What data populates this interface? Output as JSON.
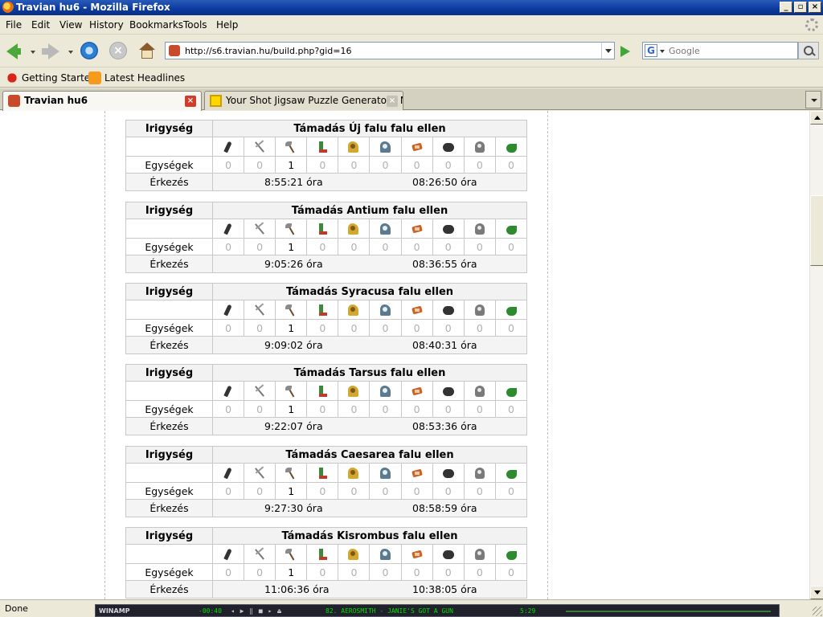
{
  "window": {
    "title": "Travian hu6 - Mozilla Firefox",
    "buttons": [
      "_",
      "▫",
      "×"
    ]
  },
  "menu": [
    "File",
    "Edit",
    "View",
    "History",
    "Bookmarks",
    "Tools",
    "Help"
  ],
  "navbar": {
    "url": "http://s6.travian.hu/build.php?gid=16",
    "search_placeholder": "Google",
    "search_engine_letter": "G"
  },
  "bookmarks": [
    "Getting Started",
    "Latest Headlines"
  ],
  "tabs": [
    {
      "label": "Travian hu6",
      "active": true
    },
    {
      "label": "Your Shot Jigsaw Puzzle Generator - N...",
      "active": false
    }
  ],
  "unit_icons": [
    "club-icon",
    "spear-icon",
    "axe-icon",
    "scout-icon",
    "paladin-icon",
    "teutonic-knight-icon",
    "ram-icon",
    "catapult-icon",
    "chief-icon",
    "settler-icon"
  ],
  "row_labels": {
    "owner": "Irigység",
    "units": "Egységek",
    "arrival": "Érkezés"
  },
  "attacks": [
    {
      "title": "Támadás Új falu falu ellen",
      "units": [
        "0",
        "0",
        "1",
        "0",
        "0",
        "0",
        "0",
        "0",
        "0",
        "0"
      ],
      "time_left": "8:55:21 óra",
      "arrival_at": "08:26:50 óra"
    },
    {
      "title": "Támadás Antium falu ellen",
      "units": [
        "0",
        "0",
        "1",
        "0",
        "0",
        "0",
        "0",
        "0",
        "0",
        "0"
      ],
      "time_left": "9:05:26 óra",
      "arrival_at": "08:36:55 óra"
    },
    {
      "title": "Támadás Syracusa falu ellen",
      "units": [
        "0",
        "0",
        "1",
        "0",
        "0",
        "0",
        "0",
        "0",
        "0",
        "0"
      ],
      "time_left": "9:09:02 óra",
      "arrival_at": "08:40:31 óra"
    },
    {
      "title": "Támadás Tarsus falu ellen",
      "units": [
        "0",
        "0",
        "1",
        "0",
        "0",
        "0",
        "0",
        "0",
        "0",
        "0"
      ],
      "time_left": "9:22:07 óra",
      "arrival_at": "08:53:36 óra"
    },
    {
      "title": "Támadás Caesarea falu ellen",
      "units": [
        "0",
        "0",
        "1",
        "0",
        "0",
        "0",
        "0",
        "0",
        "0",
        "0"
      ],
      "time_left": "9:27:30 óra",
      "arrival_at": "08:58:59 óra"
    },
    {
      "title": "Támadás Kisrombus falu ellen",
      "units": [
        "0",
        "0",
        "1",
        "0",
        "0",
        "0",
        "0",
        "0",
        "0",
        "0"
      ],
      "time_left": "11:06:36 óra",
      "arrival_at": "10:38:05 óra"
    }
  ],
  "status": {
    "text": "Done"
  },
  "winamp": {
    "logo": "WINAMP",
    "time": "-00:40",
    "controls": "◂ ▶ ‖ ■ ▸ ⏏",
    "track": "82. AEROSMITH - JANIE'S GOT A GUN",
    "length": "5:29"
  }
}
